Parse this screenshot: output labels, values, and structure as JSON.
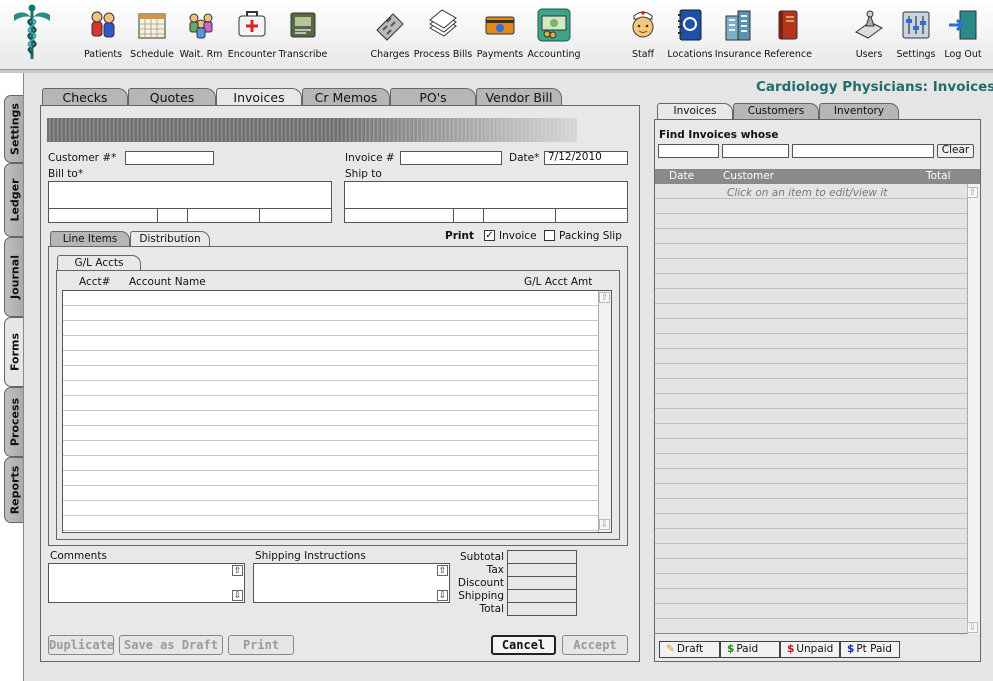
{
  "toolbar": {
    "items": [
      {
        "label": "Patients"
      },
      {
        "label": "Schedule"
      },
      {
        "label": "Wait. Rm"
      },
      {
        "label": "Encounter"
      },
      {
        "label": "Transcribe"
      },
      {
        "label": "Charges"
      },
      {
        "label": "Process Bills"
      },
      {
        "label": "Payments"
      },
      {
        "label": "Accounting"
      },
      {
        "label": "Staff"
      },
      {
        "label": "Locations"
      },
      {
        "label": "Insurance"
      },
      {
        "label": "Reference"
      },
      {
        "label": "Users"
      },
      {
        "label": "Settings"
      },
      {
        "label": "Log Out"
      }
    ]
  },
  "side_tabs": [
    "Settings",
    "Ledger",
    "Journal",
    "Forms",
    "Process",
    "Reports"
  ],
  "page_title": "Cardiology Physicians:  Invoices",
  "top_tabs": [
    "Checks",
    "Quotes",
    "Invoices",
    "Cr Memos",
    "PO's",
    "Vendor Bill"
  ],
  "form": {
    "customer_label": "Customer #*",
    "customer_value": "",
    "invoice_label": "Invoice #",
    "invoice_value": "",
    "date_label": "Date*",
    "date_value": "7/12/2010",
    "bill_to_label": "Bill to*",
    "ship_to_label": "Ship to",
    "sub_tabs": [
      "Line Items",
      "Distribution"
    ],
    "print_label": "Print",
    "print_invoice_label": "Invoice",
    "print_invoice_checked": true,
    "print_packing_label": "Packing Slip",
    "print_packing_checked": false,
    "gl_tab": "G/L Accts",
    "gl_headers": {
      "acct": "Acct#",
      "name": "Account Name",
      "amount": "G/L Acct Amt"
    },
    "comments_label": "Comments",
    "shipping_label": "Shipping Instructions",
    "totals": {
      "subtotal": "Subtotal",
      "tax": "Tax",
      "discount": "Discount",
      "shipping": "Shipping",
      "total": "Total"
    }
  },
  "buttons": {
    "duplicate": "Duplicate",
    "save_draft": "Save as Draft",
    "print": "Print",
    "cancel": "Cancel",
    "accept": "Accept"
  },
  "right_panel": {
    "tabs": [
      "Invoices",
      "Customers",
      "Inventory"
    ],
    "find_label": "Find Invoices whose",
    "clear_label": "Clear",
    "headers": {
      "date": "Date",
      "customer": "Customer",
      "total": "Total"
    },
    "hint": "Click on an item to edit/view it",
    "legend": [
      {
        "symbol": "✎",
        "label": "Draft",
        "color": "#d4a017"
      },
      {
        "symbol": "$",
        "label": "Paid",
        "color": "#1a8a1a"
      },
      {
        "symbol": "$",
        "label": "Unpaid",
        "color": "#cc1111"
      },
      {
        "symbol": "$",
        "label": "Pt Paid",
        "color": "#1a2bb0"
      }
    ]
  },
  "colors": {
    "title": "#1f6d6d",
    "panel": "#e5e5e5"
  }
}
